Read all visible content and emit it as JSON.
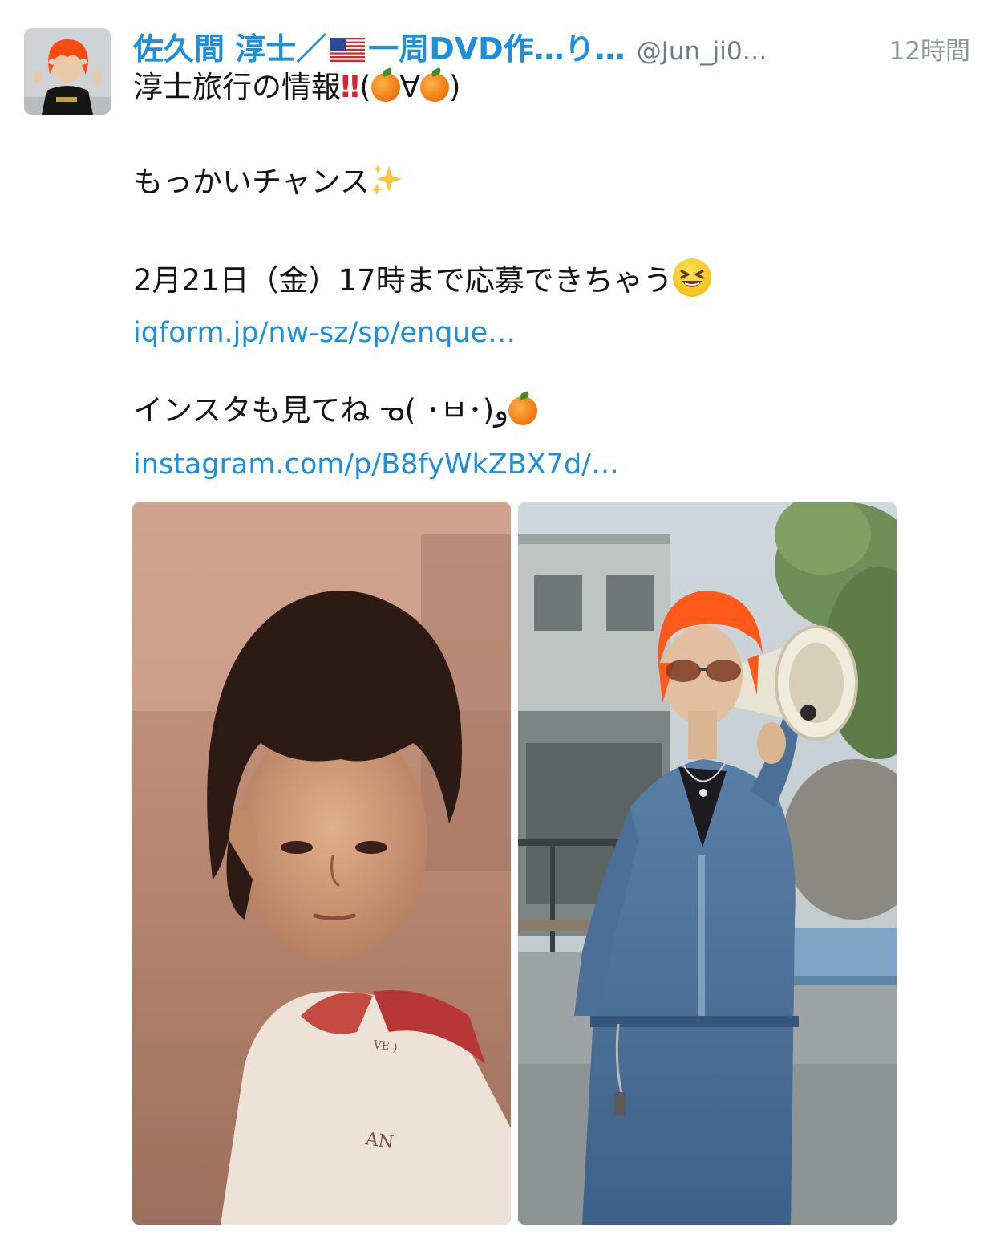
{
  "author": {
    "name_prefix": "佐久間 淳士／",
    "name_suffix": "一周DVD作…り…",
    "handle": "@Jun_ji0…",
    "timestamp": "12時間"
  },
  "tweet": {
    "line1_text": "淳士旅行の情報",
    "line1_bang": "‼",
    "line1_open": "(",
    "line1_mid": "∀",
    "line1_close": ")",
    "line2_text": "もっかいチャンス",
    "line3_text": "2月21日（金）17時まで応募できちゃう",
    "link1": "iqform.jp/nw-sz/sp/enque…",
    "line4_text": "インスタも見てね ᓀ( ･ㅂ･)و",
    "link2": "instagram.com/p/B8fyWkZBX7d/…"
  },
  "icons": {
    "avatar": "profile-avatar",
    "flag": "us-flag-icon",
    "orange": "orange-emoji-icon",
    "sparkles": "sparkles-emoji-icon",
    "laugh": "laughing-emoji-icon"
  },
  "colors": {
    "link_blue": "#1d8fdc",
    "handle_gray": "#6f7b86",
    "hair_orange": "#ff5a1a"
  }
}
